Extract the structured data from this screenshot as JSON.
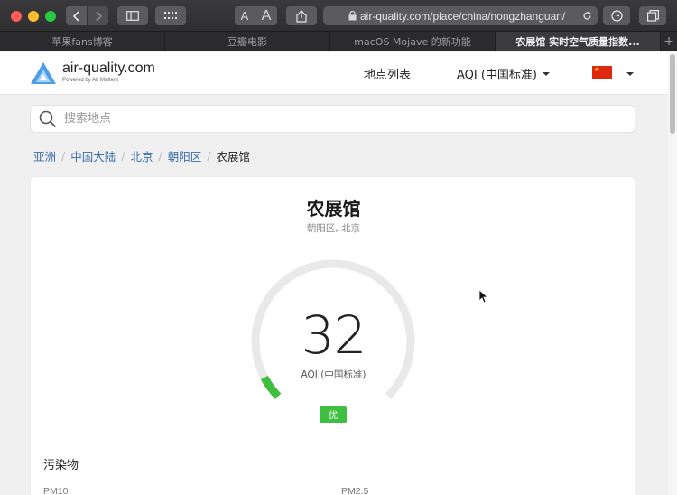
{
  "browser": {
    "font_small": "A",
    "font_large": "A",
    "url": "air-quality.com/place/china/nongzhanguan/",
    "tabs": [
      {
        "label": "苹果fans博客",
        "active": false
      },
      {
        "label": "豆瓣电影",
        "active": false
      },
      {
        "label": "macOS Mojave 的新功能",
        "active": false
      },
      {
        "label": "农展馆 实时空气质量指数...",
        "active": true
      }
    ],
    "new_tab": "+"
  },
  "site": {
    "logo_name": "air-quality.com",
    "logo_sub": "Powered by Air Matters",
    "nav_places": "地点列表",
    "nav_aqi": "AQI (中国标准)",
    "flag_star": "★"
  },
  "search": {
    "placeholder": "搜索地点"
  },
  "breadcrumb": [
    {
      "label": "亚洲"
    },
    {
      "label": "中国大陆"
    },
    {
      "label": "北京"
    },
    {
      "label": "朝阳区"
    },
    {
      "label": "农展馆"
    }
  ],
  "station": {
    "title": "农展馆",
    "subtitle": "朝阳区, 北京",
    "aqi_value": "32",
    "aqi_label": "AQI (中国标准)",
    "aqi_progress": 0.064,
    "level": "优",
    "level_color": "#3fbf3f"
  },
  "pollutants": {
    "title": "污染物",
    "items": [
      "PM10",
      "PM2.5"
    ]
  }
}
